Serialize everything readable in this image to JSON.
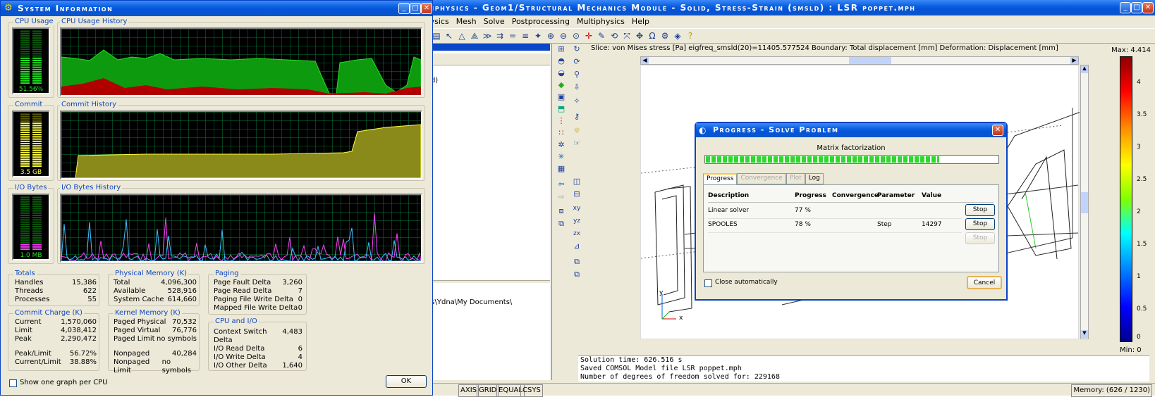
{
  "sysinfo": {
    "title": "System Information",
    "cpu_usage_label": "CPU Usage",
    "cpu_history_label": "CPU Usage History",
    "cpu_value": "51.56%",
    "commit_label": "Commit",
    "commit_history_label": "Commit History",
    "commit_value": "3.5 GB",
    "io_label": "I/O Bytes",
    "io_history_label": "I/O Bytes History",
    "io_value": "1.0 MB",
    "cpu_level": 0.52,
    "commit_level": 0.85,
    "io_level": 0.12,
    "totals": {
      "title": "Totals",
      "rows": [
        [
          "Handles",
          "15,386"
        ],
        [
          "Threads",
          "622"
        ],
        [
          "Processes",
          "55"
        ]
      ]
    },
    "commit_charge": {
      "title": "Commit Charge (K)",
      "rows": [
        [
          "Current",
          "1,570,060"
        ],
        [
          "Limit",
          "4,038,412"
        ],
        [
          "Peak",
          "2,290,472"
        ]
      ],
      "rows2": [
        [
          "Peak/Limit",
          "56.72%"
        ],
        [
          "Current/Limit",
          "38.88%"
        ]
      ]
    },
    "physical": {
      "title": "Physical Memory (K)",
      "rows": [
        [
          "Total",
          "4,096,300"
        ],
        [
          "Available",
          "528,916"
        ],
        [
          "System Cache",
          "614,660"
        ]
      ]
    },
    "kernel": {
      "title": "Kernel Memory (K)",
      "rows": [
        [
          "Paged Physical",
          "70,532"
        ],
        [
          "Paged Virtual",
          "76,776"
        ],
        [
          "Paged Limit",
          "no symbols"
        ]
      ],
      "rows2": [
        [
          "Nonpaged",
          "40,284"
        ],
        [
          "Nonpaged Limit",
          "no symbols"
        ]
      ]
    },
    "paging": {
      "title": "Paging",
      "rows": [
        [
          "Page Fault Delta",
          "3,260"
        ],
        [
          "Page Read Delta",
          "7"
        ],
        [
          "Paging File Write Delta",
          "0"
        ],
        [
          "Mapped File Write Delta",
          "0"
        ]
      ]
    },
    "cpuio": {
      "title": "CPU and I/O",
      "rows": [
        [
          "Context Switch Delta",
          "4,483"
        ],
        [
          "I/O Read Delta",
          "6"
        ],
        [
          "I/O Write Delta",
          "4"
        ],
        [
          "I/O Other Delta",
          "1,640"
        ]
      ]
    },
    "show_one_graph": "Show one graph per CPU",
    "ok": "OK"
  },
  "comsol": {
    "title": "ultiphysics - Geom1/Structural Mechanics Module - Solid, Stress-Strain (smsld) : LSR poppet.mph",
    "menu": [
      "Physics",
      "Mesh",
      "Solve",
      "Postprocessing",
      "Multiphysics",
      "Help"
    ],
    "tree_fragment": "smsld)",
    "path_fragment": "ttings\\Ydna\\My Documents\\",
    "plot_header": "Slice: von Mises stress [Pa]  eigfreq_smsld(20)=11405.577524   Boundary: Total displacement [mm]   Deformation: Displacement [mm]",
    "colorbar_max": "Max: 4.414",
    "colorbar_min": "Min: 0",
    "colorbar_ticks": [
      "4",
      "3.5",
      "3",
      "2.5",
      "2",
      "1.5",
      "1",
      "0.5",
      "0"
    ],
    "axis_x": "x",
    "axis_y": "y",
    "log_lines": [
      "Solution time: 626.516 s",
      "Saved COMSOL Model file LSR poppet.mph",
      "Number of degrees of freedom solved for: 229168"
    ],
    "status_buttons": [
      "AXIS",
      "GRID",
      "EQUAL",
      "CSYS"
    ],
    "memory": "Memory: (626 / 1230)"
  },
  "progress": {
    "title": "Progress - Solve Problem",
    "status": "Matrix factorization",
    "fill": 0.8,
    "tabs": [
      "Progress",
      "Convergence",
      "Plot",
      "Log"
    ],
    "columns": [
      "Description",
      "Progress",
      "Convergence",
      "Parameter",
      "Value"
    ],
    "rows": [
      {
        "desc": "Linear solver",
        "progress": "77 %",
        "conv": "",
        "param": "",
        "value": "",
        "stop": "Stop"
      },
      {
        "desc": "SPOOLES",
        "progress": "78 %",
        "conv": "",
        "param": "Step",
        "value": "14297",
        "stop": "Stop"
      },
      {
        "desc": "",
        "progress": "",
        "conv": "",
        "param": "",
        "value": "",
        "stop": "Stop"
      }
    ],
    "close_auto": "Close automatically",
    "cancel": "Cancel"
  }
}
